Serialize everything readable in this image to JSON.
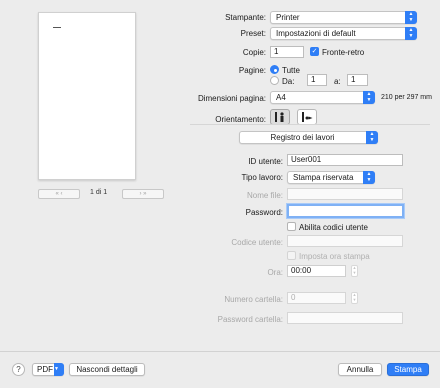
{
  "preview": {
    "prev_group": "«  ‹",
    "next_group": "›  »",
    "page_indicator": "1 di 1"
  },
  "form": {
    "printer_label": "Stampante:",
    "printer_value": "Printer",
    "preset_label": "Preset:",
    "preset_value": "Impostazioni di default",
    "copies_label": "Copie:",
    "copies_value": "1",
    "duplex_label": "Fronte-retro",
    "duplex_checked": true,
    "pages_label": "Pagine:",
    "pages_all_label": "Tutte",
    "pages_from_label": "Da:",
    "pages_from_value": "1",
    "pages_to_label": "a:",
    "pages_to_value": "1",
    "paper_size_label": "Dimensioni pagina:",
    "paper_size_value": "A4",
    "paper_size_desc": "210 per 297 mm",
    "orientation_label": "Orientamento:",
    "orientation_selected": "portrait",
    "section_value": "Registro dei lavori"
  },
  "job_log": {
    "user_id_label": "ID utente:",
    "user_id_value": "User001",
    "job_type_label": "Tipo lavoro:",
    "job_type_value": "Stampa riservata",
    "filename_label": "Nome file:",
    "filename_value": "",
    "password_label": "Password:",
    "password_value": "",
    "enable_user_codes_label": "Abilita codici utente",
    "user_code_label": "Codice utente:",
    "user_code_value": "",
    "set_print_time_label": "Imposta ora stampa",
    "time_label": "Ora:",
    "time_value": "00:00",
    "folder_number_label": "Numero cartella:",
    "folder_number_value": "0",
    "folder_password_label": "Password cartella:",
    "folder_password_value": ""
  },
  "footer": {
    "help": "?",
    "pdf_label": "PDF",
    "hide_details_label": "Nascondi dettagli",
    "cancel_label": "Annulla",
    "print_label": "Stampa"
  },
  "colors": {
    "accent": "#2f7ef6",
    "window_bg": "#ececec",
    "focus_ring": "#7fb1f5"
  }
}
